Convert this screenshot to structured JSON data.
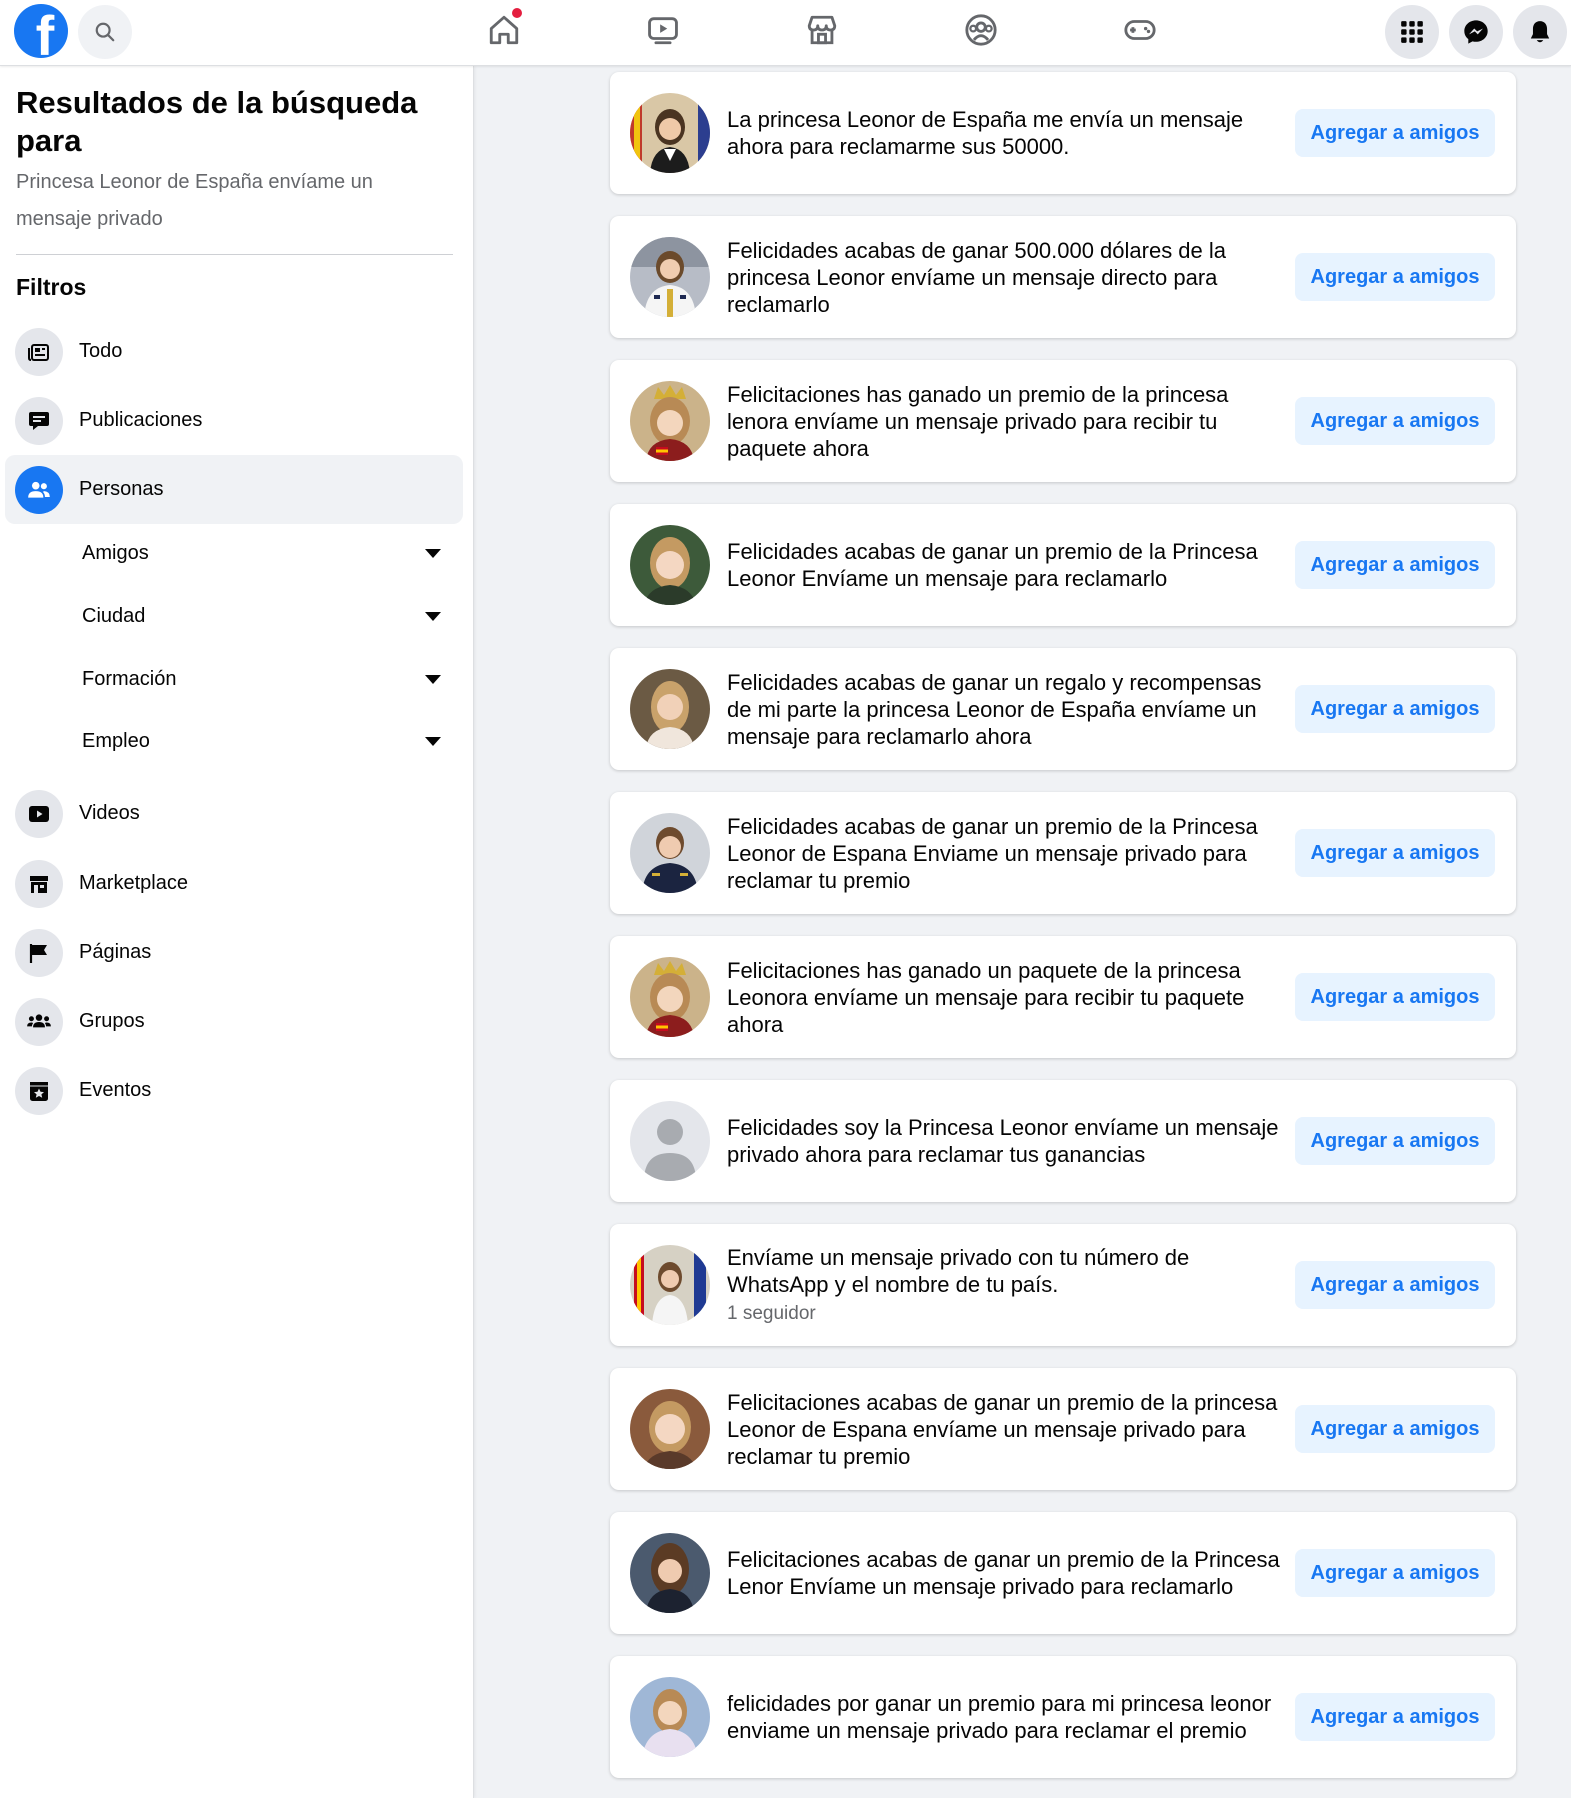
{
  "header": {
    "logo_letter": "f",
    "icons": [
      "search-icon",
      "home-icon",
      "watch-icon",
      "marketplace-icon",
      "groups-icon",
      "gaming-icon",
      "menu-grid-icon",
      "messenger-icon",
      "notifications-icon"
    ],
    "accent_color": "#1877f2",
    "badge_color": "#e41e3f"
  },
  "sidebar": {
    "title": "Resultados de la búsqueda para",
    "query": "Princesa Leonor de España envíame un mensaje privado",
    "filters_label": "Filtros",
    "filters": [
      {
        "label": "Todo",
        "icon": "posts-feed-icon"
      },
      {
        "label": "Publicaciones",
        "icon": "comment-icon"
      },
      {
        "label": "Personas",
        "icon": "people-icon",
        "active": true
      }
    ],
    "sub_filters": [
      {
        "label": "Amigos"
      },
      {
        "label": "Ciudad"
      },
      {
        "label": "Formación"
      },
      {
        "label": "Empleo"
      }
    ],
    "more_filters": [
      {
        "label": "Videos",
        "icon": "video-icon"
      },
      {
        "label": "Marketplace",
        "icon": "store-icon"
      },
      {
        "label": "Páginas",
        "icon": "flag-icon"
      },
      {
        "label": "Grupos",
        "icon": "groups-icon"
      },
      {
        "label": "Eventos",
        "icon": "event-star-icon"
      }
    ]
  },
  "results": {
    "button_label": "Agregar a amigos",
    "items": [
      {
        "name": "La princesa Leonor de España me envía un mensaje ahora para reclamarme sus 50000.",
        "subtitle": ""
      },
      {
        "name": "Felicidades acabas de ganar 500.000 dólares de la princesa Leonor envíame un mensaje directo para reclamarlo",
        "subtitle": ""
      },
      {
        "name": "Felicitaciones has ganado un premio de la princesa lenora envíame un mensaje privado para recibir tu paquete ahora",
        "subtitle": ""
      },
      {
        "name": "Felicidades acabas de ganar un premio de la Princesa Leonor Envíame un mensaje para reclamarlo",
        "subtitle": ""
      },
      {
        "name": "Felicidades acabas de ganar un regalo y recompensas de mi parte la princesa Leonor de España envíame un mensaje para reclamarlo ahora",
        "subtitle": ""
      },
      {
        "name": "Felicidades acabas de ganar un premio de la Princesa Leonor de Espana Enviame un mensaje privado para reclamar tu premio",
        "subtitle": ""
      },
      {
        "name": "Felicitaciones has ganado un paquete de la princesa Leonora envíame un mensaje para recibir tu paquete ahora",
        "subtitle": ""
      },
      {
        "name": "Felicidades soy la Princesa Leonor envíame un mensaje privado ahora para reclamar tus ganancias",
        "subtitle": ""
      },
      {
        "name": "Envíame un mensaje privado con tu número de WhatsApp y el nombre de tu país.",
        "subtitle": "1 seguidor"
      },
      {
        "name": "Felicitaciones acabas de ganar un premio de la princesa Leonor de Espana envíame un mensaje privado para reclamar tu premio",
        "subtitle": ""
      },
      {
        "name": "Felicitaciones acabas de ganar un premio de la Princesa Lenor Envíame un mensaje privado para reclamarlo",
        "subtitle": ""
      },
      {
        "name": "felicidades por ganar un premio para mi princesa leonor enviame un mensaje privado para reclamar el premio",
        "subtitle": ""
      }
    ]
  }
}
